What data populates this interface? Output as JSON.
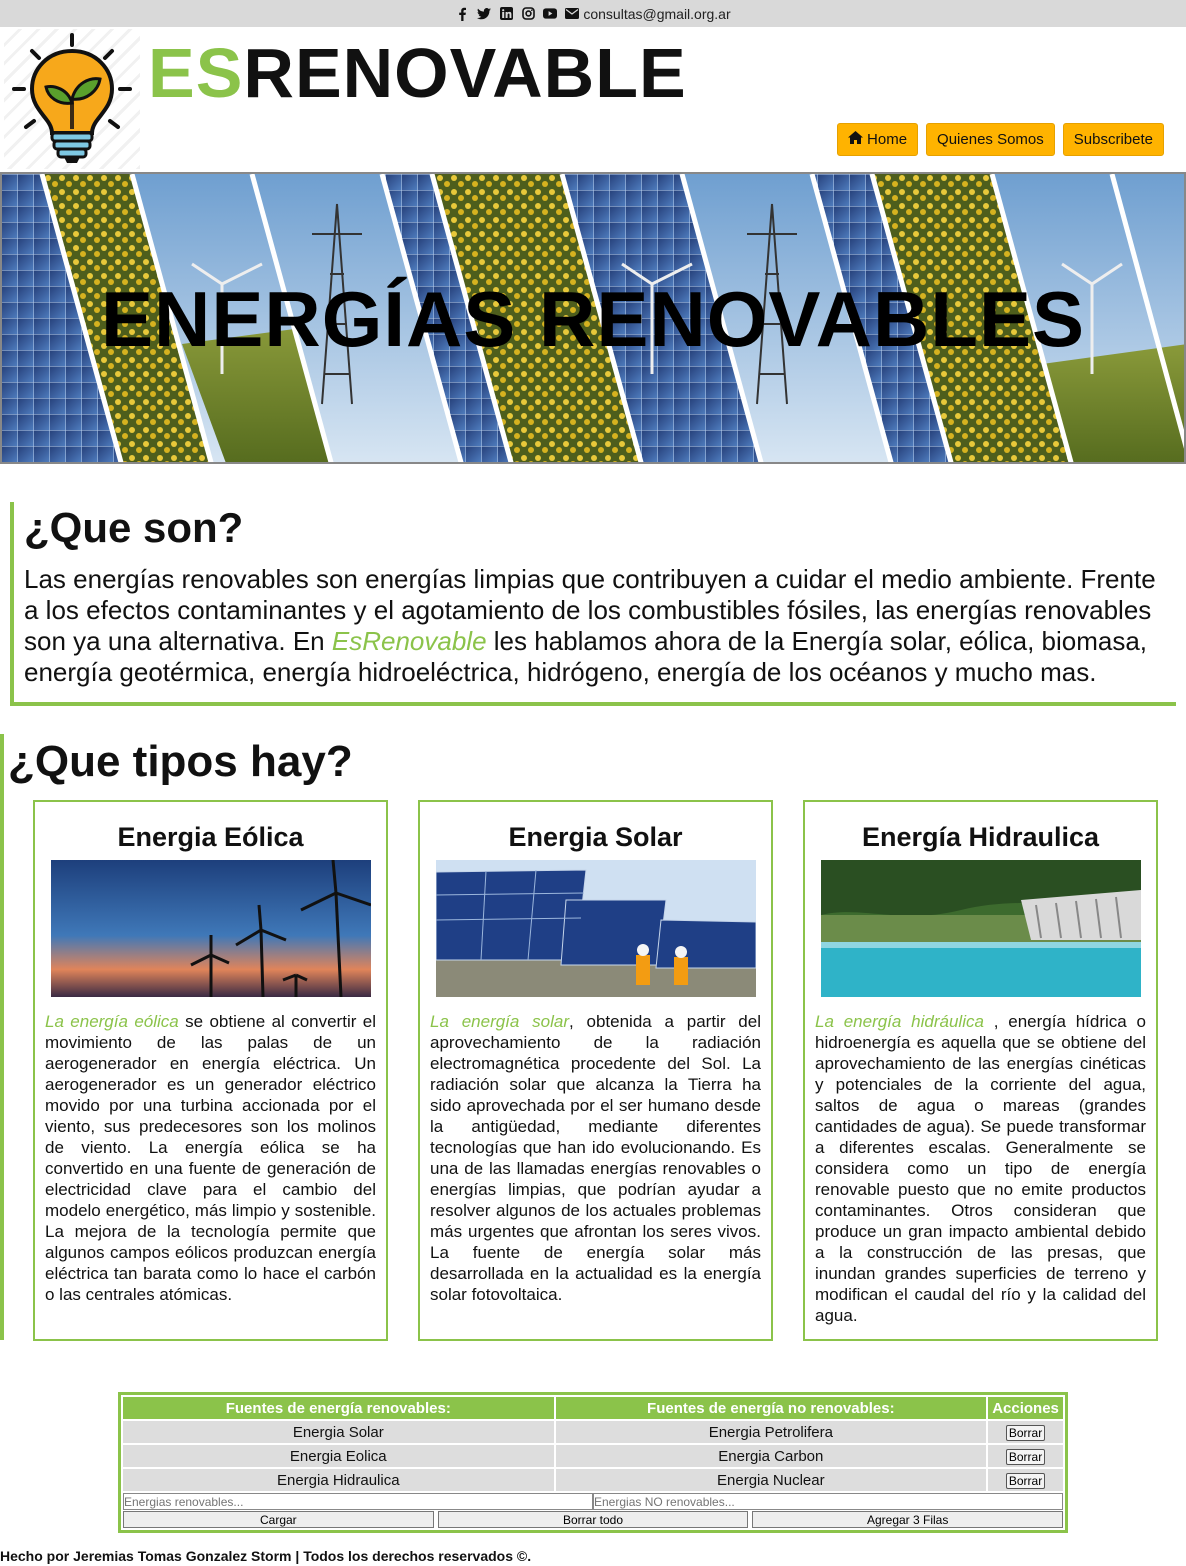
{
  "topbar": {
    "email": "consultas@gmail.org.ar",
    "icons": [
      "facebook-icon",
      "twitter-icon",
      "linkedin-icon",
      "instagram-icon",
      "youtube-icon",
      "envelope-icon"
    ]
  },
  "header": {
    "brand_es": "ES",
    "brand_rest": "RENOVABLE"
  },
  "nav": {
    "home": "Home",
    "quienes": "Quienes Somos",
    "subscribe": "Subscribete"
  },
  "banner": {
    "title": "ENERGÍAS RENOVABLES"
  },
  "que_son": {
    "title": "¿Que son?",
    "text_before": "Las energías renovables son energías limpias que contribuyen a cuidar el medio ambiente. Frente a los efectos contaminantes y el agotamiento de los combustibles fósiles, las energías renovables son ya una alternativa. En ",
    "highlight": "EsRenovable",
    "text_after": " les hablamos ahora de la Energía solar, eólica, biomasa, energía geotérmica, energía hidroeléctrica, hidrógeno, energía de los océanos y mucho mas."
  },
  "tipos": {
    "title": "¿Que tipos hay?",
    "cards": [
      {
        "title": "Energia Eólica",
        "highlight": "La energía eólica",
        "text": " se obtiene al convertir el movimiento de las palas de un aerogenerador en energía eléctrica. Un aerogenerador es un generador eléctrico movido por una turbina accionada por el viento, sus predecesores son los molinos de viento. La energía eólica se ha convertido en una fuente de generación de electricidad clave para el cambio del modelo energético, más limpio y sostenible. La mejora de la tecnología permite que algunos campos eólicos produzcan energía eléctrica tan barata como lo hace el carbón o las centrales atómicas."
      },
      {
        "title": "Energia Solar",
        "highlight": "La energía solar",
        "text": ", obtenida a partir del aprovechamiento de la radiación electromagnética procedente del Sol. La radiación solar que alcanza la Tierra ha sido aprovechada por el ser humano desde la antigüedad, mediante diferentes tecnologías que han ido evolucionando. Es una de las llamadas energías renovables o energías limpias, que podrían ayudar a resolver algunos de los actuales problemas más urgentes que afrontan los seres vivos. La fuente de energía solar más desarrollada en la actualidad es la energía solar fotovoltaica."
      },
      {
        "title": "Energía Hidraulica",
        "highlight": "La energía hidráulica",
        "text": " , energía hídrica o hidroenergía es aquella que se obtiene del aprovechamiento de las energías cinéticas y potenciales de la corriente del agua, saltos de agua o mareas (grandes cantidades de agua). Se puede transformar a diferentes escalas. Generalmente se considera como un tipo de energía renovable puesto que no emite productos contaminantes. Otros consideran que produce un gran impacto ambiental debido a la construcción de las presas, que inundan grandes superficies de terreno y modifican el caudal del río y la calidad del agua."
      }
    ]
  },
  "table": {
    "headers": [
      "Fuentes de energía renovables:",
      "Fuentes de energía no renovables:",
      "Acciones"
    ],
    "rows": [
      [
        "Energia Solar",
        "Energia Petrolifera",
        "Borrar"
      ],
      [
        "Energia Eolica",
        "Energia Carbon",
        "Borrar"
      ],
      [
        "Energia Hidraulica",
        "Energia Nuclear",
        "Borrar"
      ]
    ],
    "placeholder_renov": "Energias renovables...",
    "placeholder_no_renov": "Energias NO renovables...",
    "btn_cargar": "Cargar",
    "btn_borrar_todo": "Borrar todo",
    "btn_agregar": "Agregar 3 Filas"
  },
  "footer": {
    "text": "Hecho por Jeremias Tomas Gonzalez Storm | Todos los derechos reservados ©."
  }
}
